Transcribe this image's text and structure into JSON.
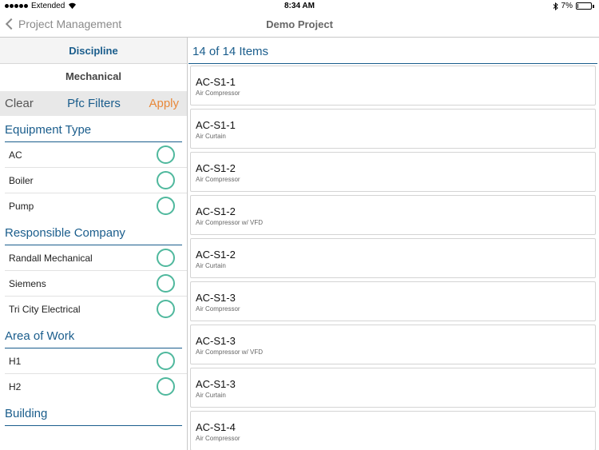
{
  "status_bar": {
    "carrier": "Extended",
    "time": "8:34 AM",
    "battery_percent": "7%",
    "battery_level": 0.07
  },
  "nav": {
    "back_label": "Project Management",
    "title": "Demo Project"
  },
  "sidebar": {
    "discipline_header": "Discipline",
    "discipline_value": "Mechanical",
    "filter_bar": {
      "clear_label": "Clear",
      "title": "Pfc Filters",
      "apply_label": "Apply"
    },
    "sections": [
      {
        "title": "Equipment Type",
        "items": [
          "AC",
          "Boiler",
          "Pump"
        ]
      },
      {
        "title": "Responsible Company",
        "items": [
          "Randall Mechanical",
          "Siemens",
          "Tri City Electrical"
        ]
      },
      {
        "title": "Area of Work",
        "items": [
          "H1",
          "H2"
        ]
      },
      {
        "title": "Building",
        "items": []
      }
    ]
  },
  "main": {
    "count_label": "14 of 14 Items",
    "items": [
      {
        "code": "AC-S1-1",
        "name": "Air Compressor"
      },
      {
        "code": "AC-S1-1",
        "name": "Air Curtain"
      },
      {
        "code": "AC-S1-2",
        "name": "Air Compressor"
      },
      {
        "code": "AC-S1-2",
        "name": "Air Compressor w/ VFD"
      },
      {
        "code": "AC-S1-2",
        "name": "Air Curtain"
      },
      {
        "code": "AC-S1-3",
        "name": "Air Compressor"
      },
      {
        "code": "AC-S1-3",
        "name": "Air Compressor w/ VFD"
      },
      {
        "code": "AC-S1-3",
        "name": "Air Curtain"
      },
      {
        "code": "AC-S1-4",
        "name": "Air Compressor"
      }
    ]
  },
  "colors": {
    "accent_blue": "#1a5d8c",
    "apply_orange": "#e8883a",
    "radio_green": "#4fb89d"
  },
  "icons": {
    "back": "chevron-left-icon",
    "wifi": "wifi-icon",
    "bluetooth": "bluetooth-icon",
    "battery": "battery-icon",
    "radio": "radio-circle-icon"
  }
}
